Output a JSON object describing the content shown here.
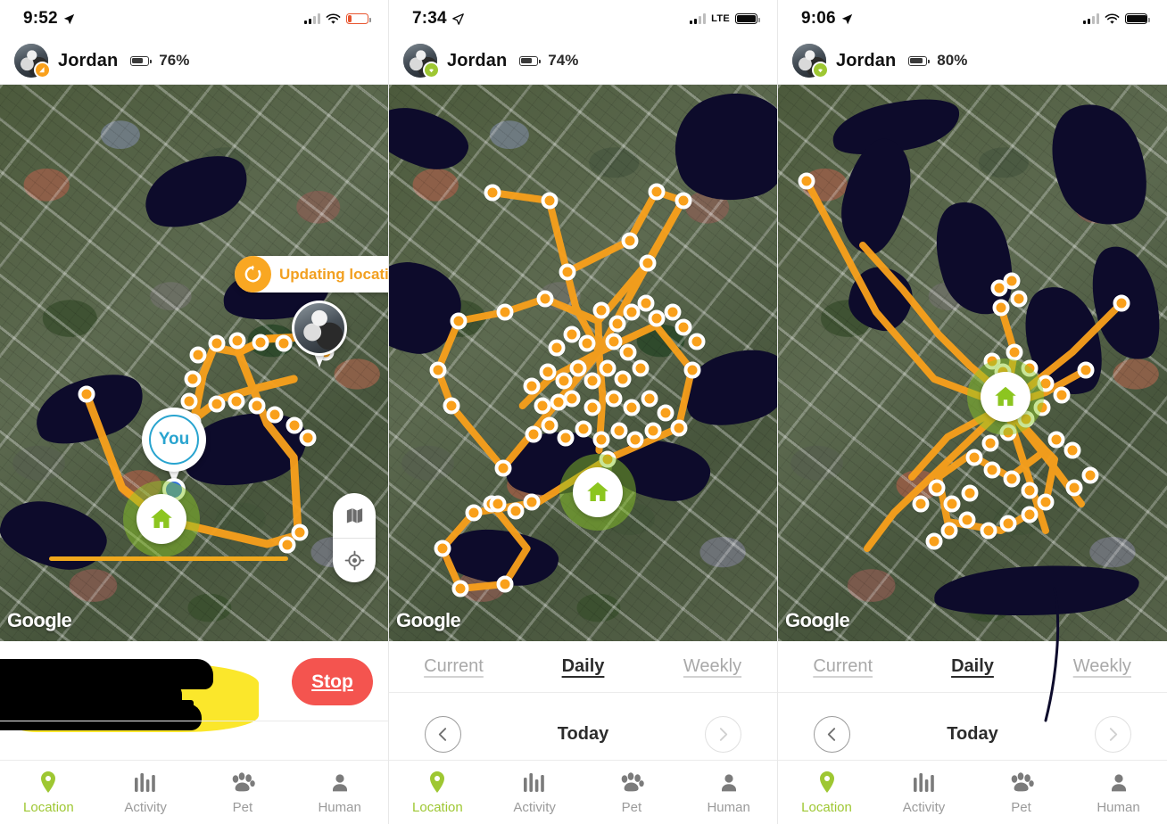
{
  "app": {
    "accent_green": "#9EC732",
    "accent_orange": "#F9A01B",
    "stop_red": "#F4544F",
    "you_blue": "#29A4CF",
    "track_orange": "#F9A01B",
    "map_watermark": "Google"
  },
  "panels": [
    {
      "id": "panel-live-tracking",
      "status": {
        "time": "9:52",
        "carrier_label": "",
        "battery_level_pct": 18,
        "battery_low": true,
        "wifi": true,
        "signal_bars": 3
      },
      "header": {
        "pet_name": "Jordan",
        "battery_text": "76%",
        "badge_icon": "signal-badge-icon",
        "badge_color": "#F9A01B",
        "avatar_icon": "pet-avatar"
      },
      "map": {
        "updating_label": "Updating location",
        "updating_icon": "refresh-icon",
        "you_label": "You",
        "home_icon": "home-icon",
        "pet_marker_icon": "pet-photo-pin",
        "controls": [
          {
            "name": "map-layers-button",
            "icon": "map-layers-icon"
          },
          {
            "name": "center-location-button",
            "icon": "crosshair-icon"
          }
        ],
        "watermark": "Google"
      },
      "bottom": {
        "stop_label": "Stop",
        "redacted": true,
        "progress_visible": true
      }
    },
    {
      "id": "panel-daily-history-1",
      "status": {
        "time": "7:34",
        "carrier_label": "LTE",
        "battery_level_pct": 92,
        "battery_low": false,
        "wifi": false,
        "signal_bars": 2
      },
      "header": {
        "pet_name": "Jordan",
        "battery_text": "74%",
        "badge_icon": "wifi-badge-icon",
        "badge_color": "#9EC732",
        "avatar_icon": "pet-avatar"
      },
      "map": {
        "home_icon": "home-icon",
        "watermark": "Google"
      },
      "tabs": [
        {
          "label": "Current",
          "active": false
        },
        {
          "label": "Daily",
          "active": true
        },
        {
          "label": "Weekly",
          "active": false
        }
      ],
      "date_nav": {
        "prev_icon": "chevron-left-icon",
        "next_icon": "chevron-right-icon",
        "label": "Today",
        "prev_enabled": true,
        "next_enabled": false
      }
    },
    {
      "id": "panel-daily-history-2",
      "status": {
        "time": "9:06",
        "carrier_label": "",
        "battery_level_pct": 96,
        "battery_low": false,
        "wifi": true,
        "signal_bars": 3
      },
      "header": {
        "pet_name": "Jordan",
        "battery_text": "80%",
        "badge_icon": "wifi-badge-icon",
        "badge_color": "#9EC732",
        "avatar_icon": "pet-avatar"
      },
      "map": {
        "home_icon": "home-icon",
        "watermark": "Google"
      },
      "tabs": [
        {
          "label": "Current",
          "active": false
        },
        {
          "label": "Daily",
          "active": true
        },
        {
          "label": "Weekly",
          "active": false
        }
      ],
      "date_nav": {
        "prev_icon": "chevron-left-icon",
        "next_icon": "chevron-right-icon",
        "label": "Today",
        "prev_enabled": true,
        "next_enabled": false
      }
    }
  ],
  "tabbar": [
    {
      "label": "Location",
      "icon": "location-pin-icon",
      "active": true
    },
    {
      "label": "Activity",
      "icon": "bar-chart-icon",
      "active": false
    },
    {
      "label": "Pet",
      "icon": "paw-icon",
      "active": false
    },
    {
      "label": "Human",
      "icon": "person-icon",
      "active": false
    }
  ]
}
